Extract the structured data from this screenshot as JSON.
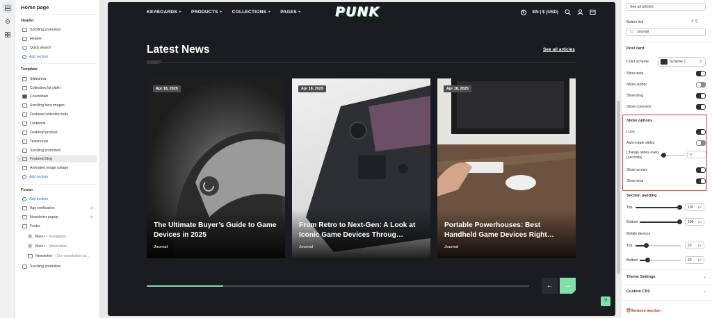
{
  "left_panel": {
    "title": "Home page",
    "header_group": "Header",
    "header_items": [
      "Scrolling promotion",
      "Header",
      "Quick search"
    ],
    "add_section": "Add section",
    "template_group": "Template",
    "template_items": [
      "Slideshow",
      "Collection list slider",
      "Countdown",
      "Scrolling hero images",
      "Featured collection tabs",
      "Lookbook",
      "Featured product",
      "Testimonial",
      "Scrolling promotion",
      "Featured blog",
      "Animated image collage"
    ],
    "footer_group": "Footer",
    "footer_items": [
      "Age verification",
      "Newsletter popup",
      "Footer"
    ],
    "footer_sub": [
      {
        "label": "Menu",
        "sub": "Navigation"
      },
      {
        "label": "Menu",
        "sub": "Information"
      },
      {
        "label": "Newsletter",
        "sub": "Our newsletters ar..."
      }
    ],
    "footer_last": "Scrolling promotion"
  },
  "store": {
    "nav": [
      "KEYBOARDS",
      "PRODUCTS",
      "COLLECTIONS",
      "PAGES"
    ],
    "logo": "PUNK",
    "currency": "EN | $ (USD)",
    "heading": "Latest News",
    "see_all": "See all articles",
    "cards": [
      {
        "date": "Apr 18, 2025",
        "title": "The Ultimate Buyer’s Guide to Game Devices in 2025",
        "tag": "Journal"
      },
      {
        "date": "Apr 18, 2025",
        "title": "From Retro to Next-Gen: A Look at Iconic Game Devices Throug…",
        "tag": "Journal"
      },
      {
        "date": "Apr 18, 2025",
        "title": "Portable Powerhouses: Best Handheld Game Devices Right…",
        "tag": "Journal"
      }
    ],
    "progress_fraction": 0.2,
    "accent": "#7fe0a9",
    "prev_icon": "←",
    "next_icon": "→"
  },
  "right_panel": {
    "button_label_value": "See all articles",
    "button_link_label": "Button link",
    "button_link_value": "Journal",
    "post_card": "Post card",
    "color_scheme_label": "Color scheme",
    "color_scheme_value": "Scheme 1",
    "show_date": "Show date",
    "show_author": "Show author",
    "show_blog": "Show blog",
    "show_comment": "Show comment",
    "slider_options": "Slider options",
    "loop": "Loop",
    "auto_rotate": "Auto-rotate slides",
    "change_slides": "Change slides every (seconds)",
    "change_slides_value": "5",
    "show_arrows": "Show arrows",
    "show_dots": "Show dots",
    "section_padding": "Section padding",
    "top": "Top",
    "bottom": "Bottom",
    "top_value": "100",
    "bottom_value": "100",
    "mobile_devices": "Mobile devices",
    "m_top_value": "20",
    "m_bottom_value": "20",
    "unit": "px",
    "theme_settings": "Theme Settings",
    "custom_css": "Custom CSS",
    "remove_section": "Remove section",
    "highlight_color": "#d9502e"
  }
}
